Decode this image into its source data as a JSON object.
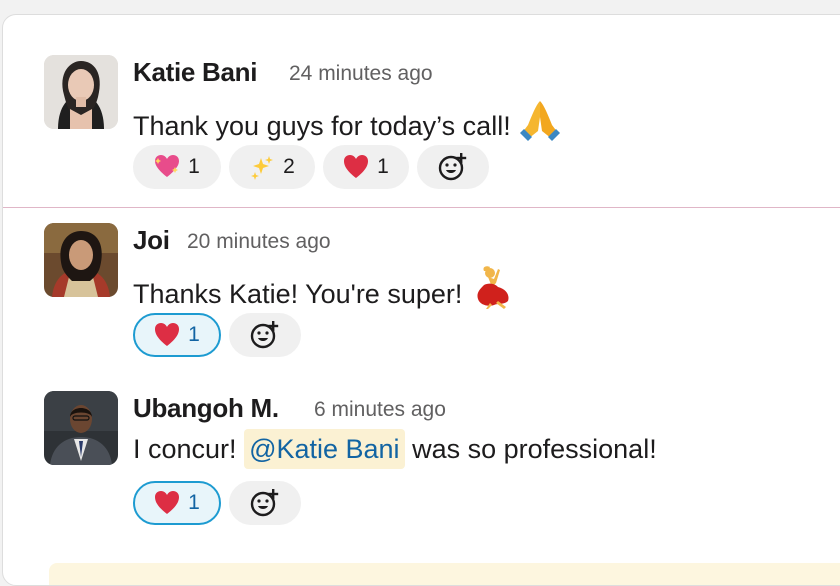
{
  "messages": [
    {
      "author": "Katie Bani",
      "time": "24 minutes ago",
      "text": "Thank you guys for today’s call!",
      "text_emoji": "folded-hands-emoji",
      "reactions": [
        {
          "emoji": "sparkling-heart",
          "count": "1",
          "active": false
        },
        {
          "emoji": "sparkles",
          "count": "2",
          "active": false
        },
        {
          "emoji": "red-heart",
          "count": "1",
          "active": false
        }
      ]
    },
    {
      "author": "Joi",
      "time": "20 minutes ago",
      "text": "Thanks Katie! You're super!",
      "text_emoji": "dancer-emoji",
      "reactions": [
        {
          "emoji": "red-heart",
          "count": "1",
          "active": true
        }
      ]
    },
    {
      "author": "Ubangoh M.",
      "time": "6 minutes ago",
      "text_before": "I concur!",
      "mention": "@Katie Bani",
      "text_after": "was so professional!",
      "reactions": [
        {
          "emoji": "red-heart",
          "count": "1",
          "active": true
        }
      ]
    }
  ],
  "colors": {
    "mention_bg": "#fbf1d3",
    "mention_text": "#1264a3",
    "active_reaction_border": "#1d9bd1",
    "active_reaction_bg": "#e8f5fa",
    "divider": "#e0b6c7"
  }
}
